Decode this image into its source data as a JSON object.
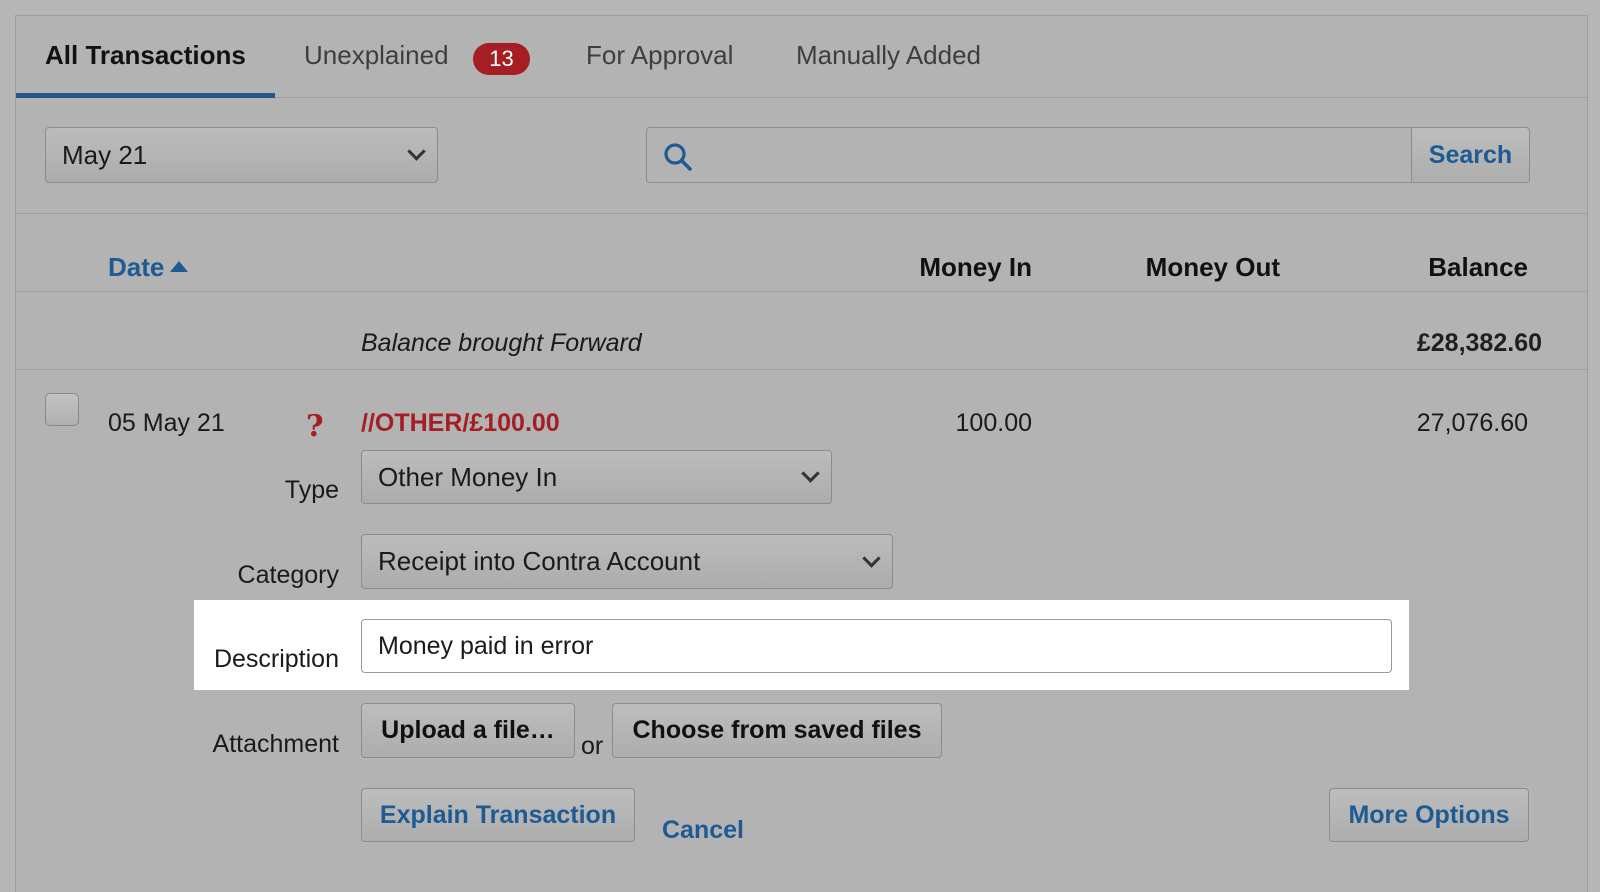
{
  "tabs": [
    {
      "label": "All Transactions",
      "active": true
    },
    {
      "label": "Unexplained",
      "badge": "13"
    },
    {
      "label": "For Approval"
    },
    {
      "label": "Manually Added"
    }
  ],
  "filters": {
    "period_value": "May 21",
    "search_value": "",
    "search_button": "Search"
  },
  "table_header": {
    "date": "Date",
    "money_in": "Money In",
    "money_out": "Money Out",
    "balance": "Balance"
  },
  "balance_forward": {
    "label": "Balance brought Forward",
    "value": "£28,382.60"
  },
  "transaction": {
    "date": "05 May 21",
    "status_icon": "?",
    "reference": "//OTHER/£100.00",
    "money_in": "100.00",
    "balance": "27,076.60"
  },
  "form": {
    "type_label": "Type",
    "type_value": "Other Money In",
    "category_label": "Category",
    "category_value": "Receipt into Contra Account",
    "description_label": "Description",
    "description_value": "Money paid in error",
    "attachment_label": "Attachment",
    "upload_button": "Upload a file…",
    "or_text": "or",
    "saved_files_button": "Choose from saved files",
    "explain_button": "Explain Transaction",
    "cancel_link": "Cancel",
    "more_options_button": "More Options"
  },
  "colors": {
    "accent": "#1e5a93",
    "alert": "#a41e23",
    "background": "#b3b3b3",
    "highlight": "#ffffff"
  }
}
